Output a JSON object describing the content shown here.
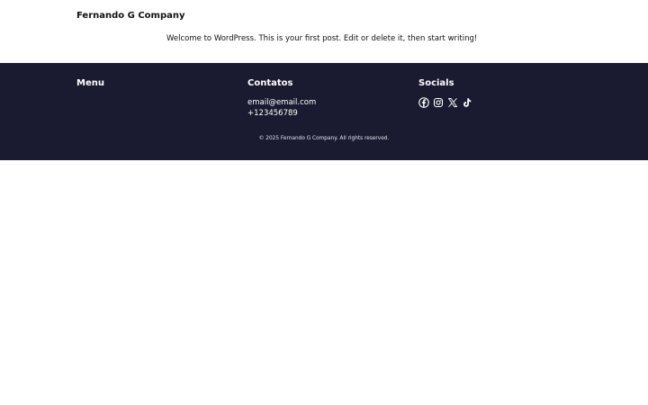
{
  "header": {
    "site_title": "Fernando G Company"
  },
  "main": {
    "post_text": "Welcome to WordPress. This is your first post. Edit or delete it, then start writing!"
  },
  "footer": {
    "menu_heading": "Menu",
    "contacts_heading": "Contatos",
    "email": "email@email.com",
    "phone": "+123456789",
    "socials_heading": "Socials",
    "social_icons": [
      "facebook-icon",
      "instagram-icon",
      "x-icon",
      "tiktok-icon"
    ],
    "copyright": "© 2025 Fernando G Company. All rights reserved.",
    "background_color": "#1a1b30"
  }
}
